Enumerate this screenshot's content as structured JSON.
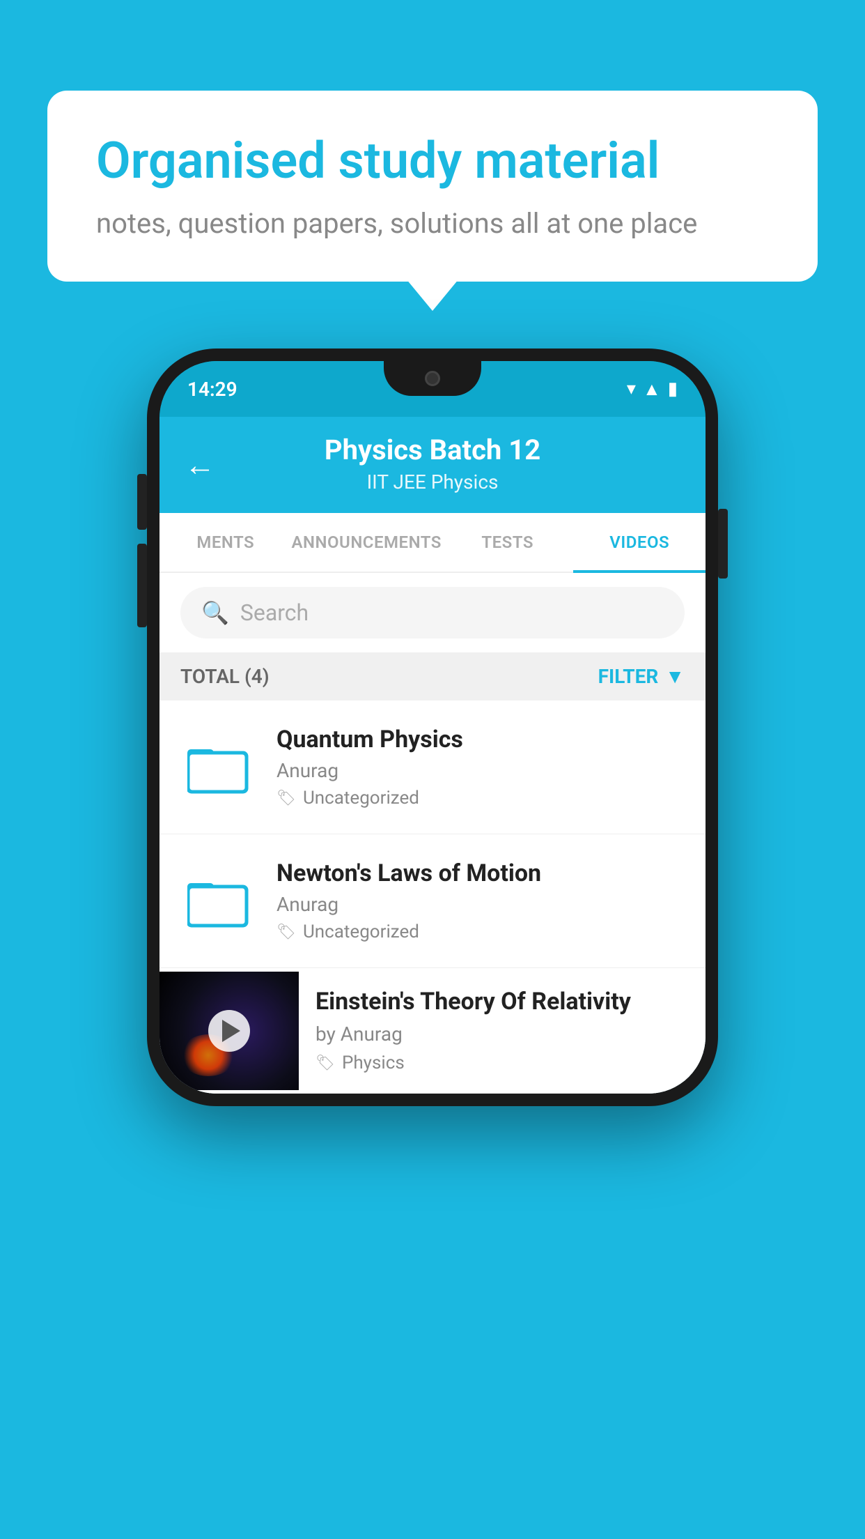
{
  "background_color": "#1BB8E0",
  "speech_bubble": {
    "title": "Organised study material",
    "subtitle": "notes, question papers, solutions all at one place"
  },
  "phone": {
    "status_bar": {
      "time": "14:29"
    },
    "header": {
      "title": "Physics Batch 12",
      "subtitle": "IIT JEE   Physics",
      "back_label": "←"
    },
    "tabs": [
      {
        "label": "MENTS",
        "active": false
      },
      {
        "label": "ANNOUNCEMENTS",
        "active": false
      },
      {
        "label": "TESTS",
        "active": false
      },
      {
        "label": "VIDEOS",
        "active": true
      }
    ],
    "search": {
      "placeholder": "Search"
    },
    "filter_bar": {
      "total_label": "TOTAL (4)",
      "filter_label": "FILTER"
    },
    "video_items": [
      {
        "title": "Quantum Physics",
        "author": "Anurag",
        "tag": "Uncategorized",
        "type": "folder"
      },
      {
        "title": "Newton's Laws of Motion",
        "author": "Anurag",
        "tag": "Uncategorized",
        "type": "folder"
      },
      {
        "title": "Einstein's Theory Of Relativity",
        "author": "by Anurag",
        "tag": "Physics",
        "type": "video"
      }
    ]
  }
}
